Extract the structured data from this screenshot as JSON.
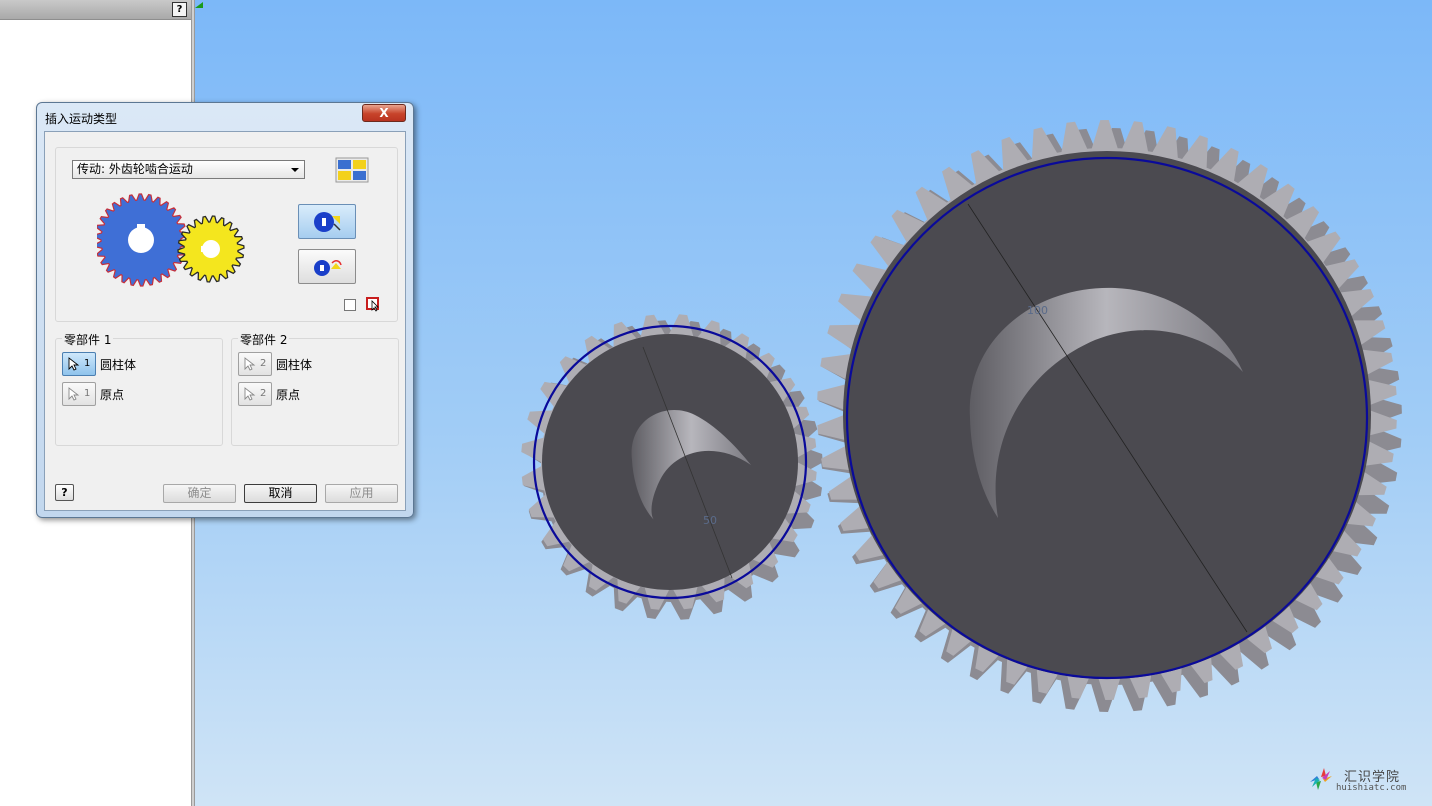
{
  "browser_panel": {
    "help_label": "?"
  },
  "dialog": {
    "title": "插入运动类型",
    "close_label": "X",
    "motion_type": "传动: 外齿轮啮合运动",
    "component1": {
      "label": "零部件 1",
      "selection1": {
        "num": "1",
        "text": "圆柱体"
      },
      "selection2": {
        "num": "1",
        "text": "原点"
      }
    },
    "component2": {
      "label": "零部件 2",
      "selection1": {
        "num": "2",
        "text": "圆柱体"
      },
      "selection2": {
        "num": "2",
        "text": "原点"
      }
    },
    "help_label": "?",
    "ok_label": "确定",
    "cancel_label": "取消",
    "apply_label": "应用"
  },
  "viewport": {
    "small_gear_dim": "50",
    "large_gear_dim": "100",
    "gear_color": "#4b4a50",
    "pitch_circle_color": "#0a0a9a"
  },
  "watermark": {
    "title": "汇识学院",
    "url": "huishiatc.com"
  }
}
